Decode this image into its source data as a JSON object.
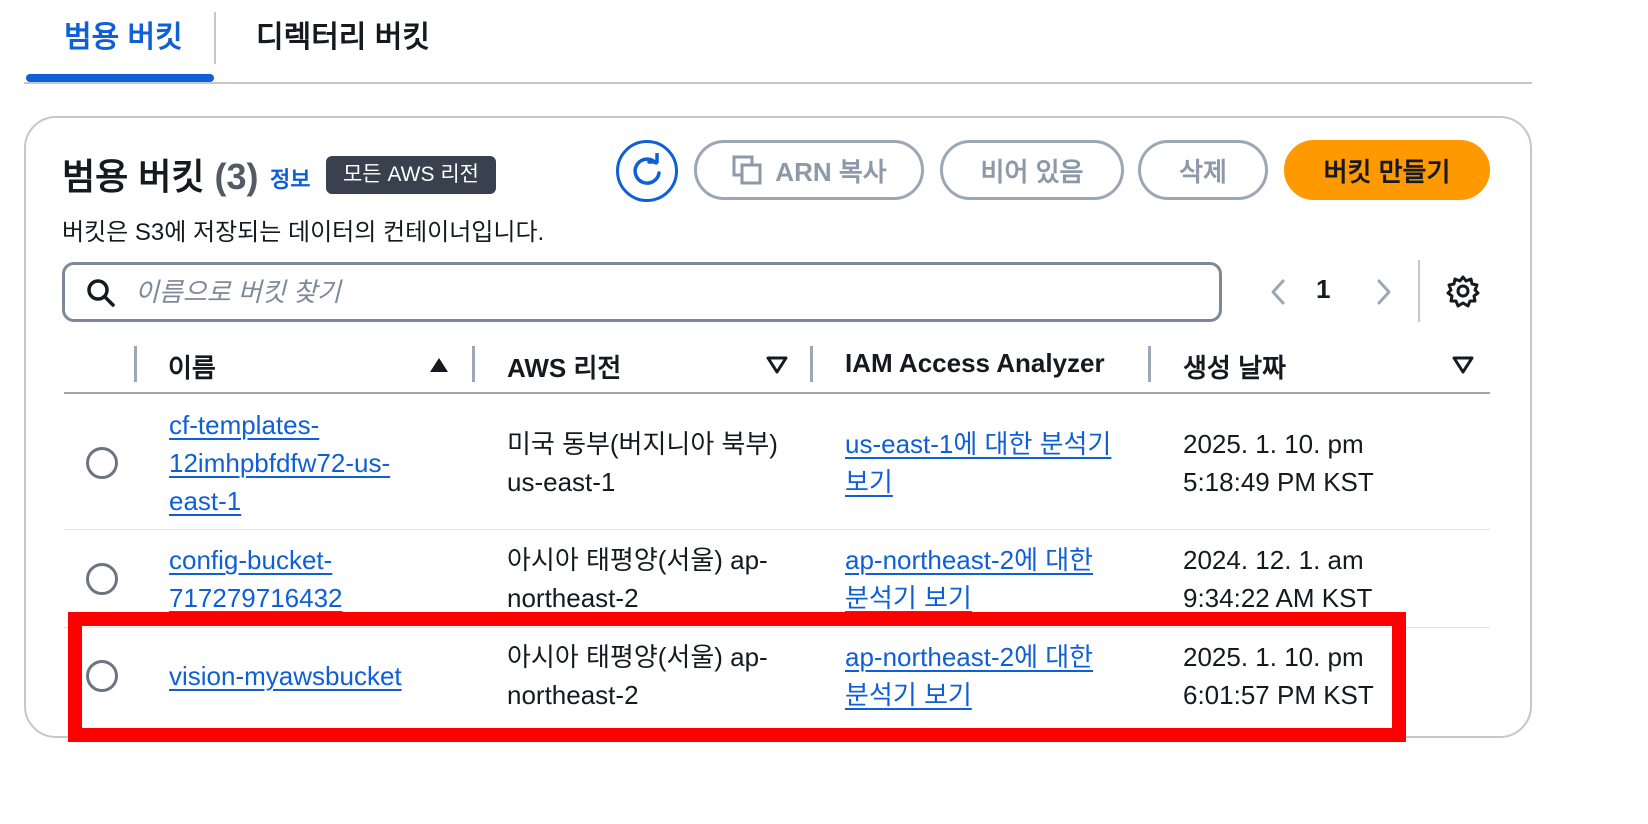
{
  "tabs": [
    {
      "label": "범용 버킷",
      "active": true
    },
    {
      "label": "디렉터리 버킷",
      "active": false
    }
  ],
  "header": {
    "title": "범용 버킷",
    "count": "(3)",
    "info_link": "정보",
    "region_badge": "모든 AWS 리전",
    "description": "버킷은 S3에 저장되는 데이터의 컨테이너입니다."
  },
  "actions": {
    "refresh_icon": "refresh-icon",
    "copy_arn": "ARN 복사",
    "empty": "비어 있음",
    "delete": "삭제",
    "create": "버킷 만들기"
  },
  "search": {
    "placeholder": "이름으로 버킷 찾기",
    "value": ""
  },
  "pagination": {
    "current_page": "1"
  },
  "table": {
    "columns": [
      "이름",
      "AWS 리전",
      "IAM Access Analyzer",
      "생성 날짜"
    ],
    "sort": {
      "column": "이름",
      "direction": "ascending"
    },
    "rows": [
      {
        "name_lines": [
          "cf-templates-",
          "12imhpbfdfw72-us-",
          "east-1"
        ],
        "region_lines": [
          "미국 동부(버지니아 북부)",
          "us-east-1"
        ],
        "analyzer_lines": [
          "us-east-1에 대한 분석기",
          "보기"
        ],
        "created_lines": [
          "2025. 1. 10. pm",
          "5:18:49 PM KST"
        ]
      },
      {
        "name_lines": [
          "config-bucket-",
          "717279716432"
        ],
        "region_lines": [
          "아시아 태평양(서울) ap-",
          "northeast-2"
        ],
        "analyzer_lines": [
          "ap-northeast-2에 대한",
          "분석기 보기"
        ],
        "created_lines": [
          "2024. 12. 1. am",
          "9:34:22 AM KST"
        ]
      },
      {
        "name_lines": [
          "vision-myawsbucket"
        ],
        "region_lines": [
          "아시아 태평양(서울) ap-",
          "northeast-2"
        ],
        "analyzer_lines": [
          "ap-northeast-2에 대한",
          "분석기 보기"
        ],
        "created_lines": [
          "2025. 1. 10. pm",
          "6:01:57 PM KST"
        ]
      }
    ]
  },
  "colors": {
    "accent": "#0f5fd6",
    "primary_button": "#ff9900",
    "highlight": "#ff0000"
  }
}
